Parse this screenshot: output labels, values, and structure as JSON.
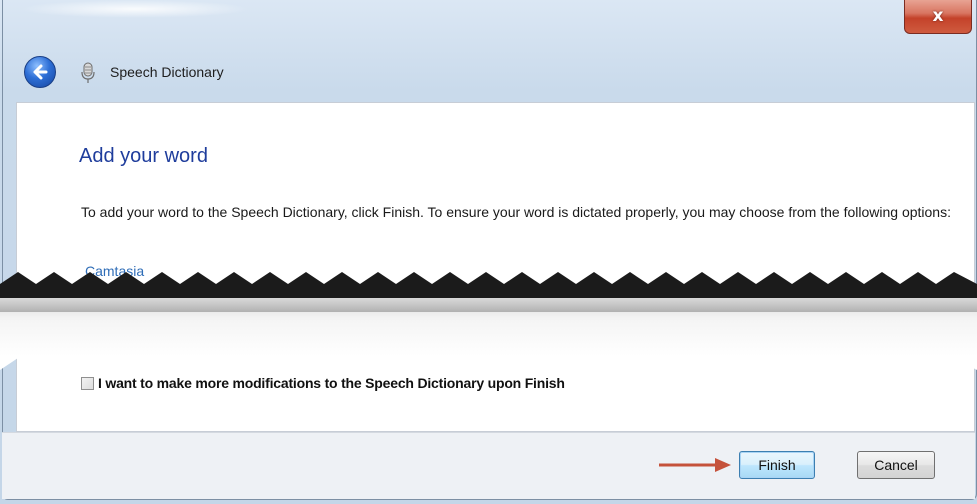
{
  "window": {
    "close_glyph": "x",
    "title": "Speech Dictionary"
  },
  "nav": {
    "back_icon": "back-arrow-icon",
    "app_icon": "microphone-icon"
  },
  "content": {
    "heading": "Add your word",
    "description": "To add your word to the Speech Dictionary, click Finish.  To ensure your word is dictated properly, you may choose from the following options:",
    "option_link": "Camtasia",
    "checkbox_label": "I want to make more modifications to the Speech Dictionary upon Finish",
    "checkbox_checked": false
  },
  "footer": {
    "finish_label": "Finish",
    "cancel_label": "Cancel"
  },
  "colors": {
    "heading": "#1f3d9c",
    "link": "#2f6db7",
    "arrow": "#c5523b",
    "close_button": "#c4422a"
  }
}
